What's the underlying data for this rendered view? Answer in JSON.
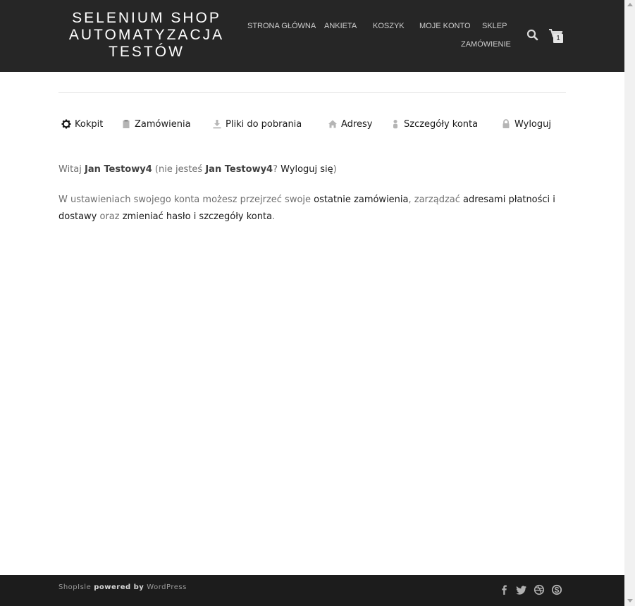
{
  "header": {
    "logo_lines": [
      "SELENIUM SHOP",
      "AUTOMATYZACJA",
      "TESTÓW"
    ],
    "nav": {
      "home": "STRONA GŁÓWNA",
      "survey": "ANKIETA",
      "cart": "KOSZYK",
      "account": "MOJE KONTO",
      "shop": "SKLEP",
      "order": "ZAMÓWIENIE"
    },
    "cart_count": "1",
    "icons": {
      "search": "search-icon",
      "cart": "cart-icon"
    }
  },
  "account_nav": {
    "dashboard": "Kokpit",
    "orders": "Zamówienia",
    "downloads": "Pliki do pobrania",
    "addresses": "Adresy",
    "details": "Szczegóły konta",
    "logout": "Wyloguj"
  },
  "content": {
    "greeting_prefix": "Witaj ",
    "user_name": "Jan Testowy4",
    "not_you_prefix": " (nie jesteś ",
    "not_you_name": "Jan Testowy4",
    "question_mark": "? ",
    "logout_link": "Wyloguj się",
    "close_paren": ")",
    "desc_1": "W ustawieniach swojego konta możesz przejrzeć swoje ",
    "link_orders": "ostatnie zamówienia",
    "desc_2": ", zarządzać ",
    "link_addresses": "adresami płatności i dostawy",
    "desc_3": " oraz ",
    "link_password": "zmieniać hasło i szczegóły konta",
    "desc_4": "."
  },
  "footer": {
    "brand": "ShopIsle",
    "powered": " powered by ",
    "platform": "WordPress",
    "social_icons": [
      "facebook-icon",
      "twitter-icon",
      "dribbble-icon",
      "skype-icon"
    ]
  },
  "colors": {
    "header_bg": "#262626",
    "footer_bg": "#1c1c1c",
    "body_text": "#6f6f6f",
    "link_text": "#1a1a1a"
  }
}
